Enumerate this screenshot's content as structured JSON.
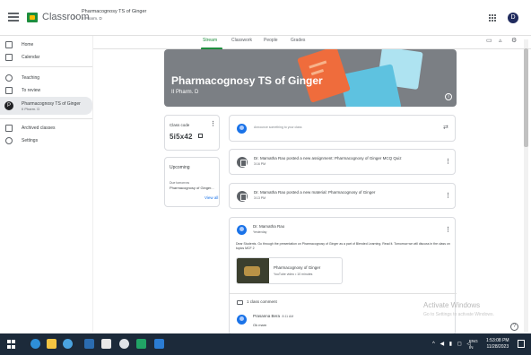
{
  "topbar": {
    "app_name": "Classroom",
    "crumb_arrow": "›",
    "class_title": "Pharmacognosy TS of Ginger",
    "class_section": "II Pharm. D",
    "avatar_letter": "D"
  },
  "sidebar": {
    "home": "Home",
    "calendar": "Calendar",
    "teaching": "Teaching",
    "to_review": "To review",
    "class_name": "Pharmacognosy TS of Ginger",
    "class_sub": "II Pharm. D",
    "class_avatar": "P",
    "archived": "Archived classes",
    "settings": "Settings"
  },
  "tabs": {
    "stream": "Stream",
    "classwork": "Classwork",
    "people": "People",
    "grades": "Grades"
  },
  "banner": {
    "title": "Pharmacognosy TS of Ginger",
    "section": "II Pharm. D"
  },
  "class_code": {
    "label": "Class code",
    "value": "5i5x42"
  },
  "upcoming": {
    "title": "Upcoming",
    "due": "Due tomorrow",
    "item": "Pharmacognosy of Ginger...",
    "view_all": "View all"
  },
  "announce": {
    "placeholder": "Announce something to your class"
  },
  "stream": [
    {
      "title": "Dr. Mamatha Rao posted a new assignment: Pharmacognosy of Ginger MCQ Quiz",
      "date": "3:16 PM"
    },
    {
      "title": "Dr. Mamatha Rao posted a new material: Pharmacognosy of Ginger",
      "date": "3:13 PM"
    }
  ],
  "announcement": {
    "author": "Dr. Mamatha Rao",
    "date": "Yesterday",
    "body": "Dear Students. Go through the presentation on Pharmacognosy of Ginger as a part of Blended Learning. Read it. Tomorrow we will discuss in the class on topics MCF 2",
    "attachment_title": "Pharmacognosy of Ginger",
    "attachment_sub": "YouTube video • 10 minutes",
    "comment_count": "1 class comment",
    "comment_author": "Prasanna Bera",
    "comment_time": "8:11 AM",
    "comment_text": "Ok mam"
  },
  "watermark": {
    "line1": "Activate Windows",
    "line2": "Go to Settings to activate Windows."
  },
  "taskbar": {
    "lang1": "ENG",
    "lang2": "IN",
    "time": "1:53:08 PM",
    "date": "11/28/2023"
  },
  "colors": {
    "accent": "#1e8e3e",
    "banner": "#7b7f84",
    "taskbar": "#1c2a3a",
    "link": "#1a73e8"
  }
}
